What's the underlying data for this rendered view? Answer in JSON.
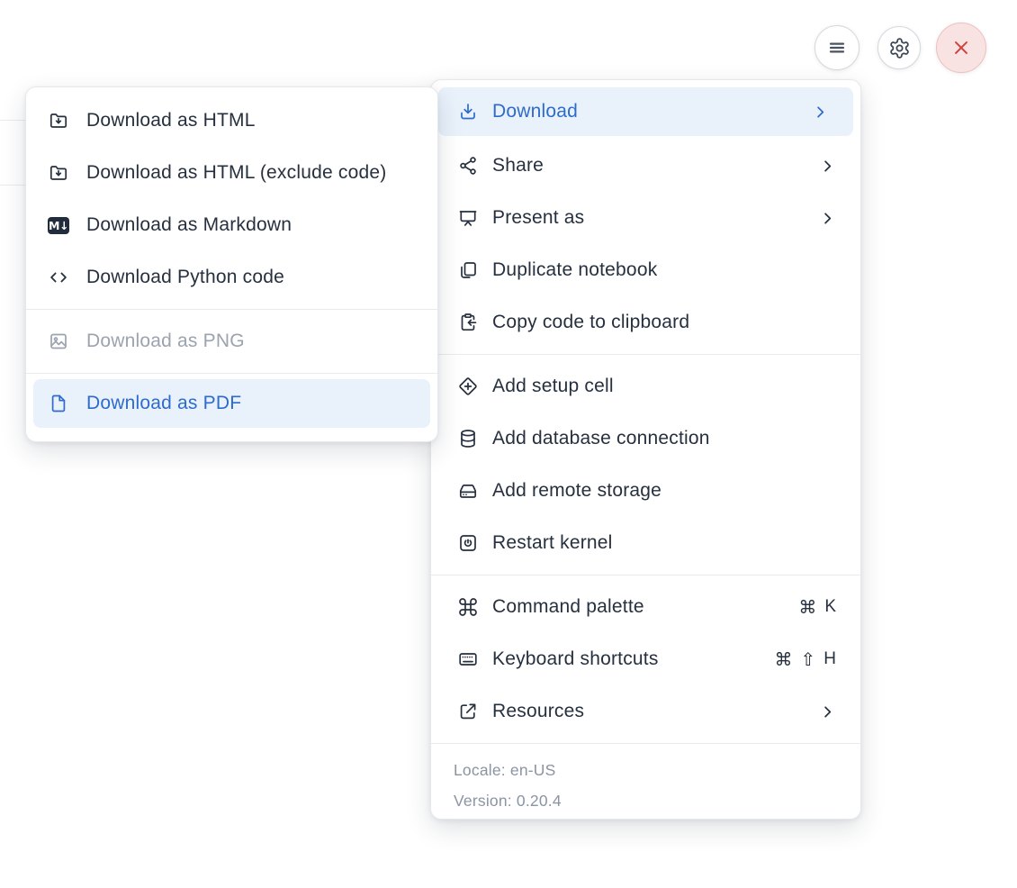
{
  "toolbar": {
    "menu_button": {
      "icon": "hamburger-icon"
    },
    "settings_button": {
      "icon": "gear-icon"
    },
    "close_button": {
      "icon": "close-icon"
    }
  },
  "submenu": {
    "items": [
      {
        "label": "Download as HTML",
        "icon": "folder-download-icon",
        "state": "normal"
      },
      {
        "label": "Download as HTML (exclude code)",
        "icon": "folder-download-icon",
        "state": "normal"
      },
      {
        "label": "Download as Markdown",
        "icon": "markdown-icon",
        "badge": "M↓",
        "state": "normal"
      },
      {
        "label": "Download Python code",
        "icon": "code-icon",
        "state": "normal"
      },
      {
        "label": "Download as PNG",
        "icon": "image-icon",
        "state": "disabled"
      },
      {
        "label": "Download as PDF",
        "icon": "file-icon",
        "state": "highlighted"
      }
    ]
  },
  "main_menu": {
    "items": [
      {
        "label": "Download",
        "icon": "download-icon",
        "submenu": true,
        "state": "highlighted"
      },
      {
        "label": "Share",
        "icon": "share-icon",
        "submenu": true,
        "state": "normal"
      },
      {
        "label": "Present as",
        "icon": "presentation-icon",
        "submenu": true,
        "state": "normal"
      },
      {
        "label": "Duplicate notebook",
        "icon": "duplicate-icon",
        "state": "normal"
      },
      {
        "label": "Copy code to clipboard",
        "icon": "clipboard-arrow-icon",
        "state": "normal"
      },
      {
        "label": "Add setup cell",
        "icon": "diamond-plus-icon",
        "state": "normal"
      },
      {
        "label": "Add database connection",
        "icon": "database-icon",
        "state": "normal"
      },
      {
        "label": "Add remote storage",
        "icon": "hard-drive-icon",
        "state": "normal"
      },
      {
        "label": "Restart kernel",
        "icon": "power-square-icon",
        "state": "normal"
      },
      {
        "label": "Command palette",
        "icon": "command-icon",
        "shortcut": [
          "⌘",
          "K"
        ],
        "state": "normal"
      },
      {
        "label": "Keyboard shortcuts",
        "icon": "keyboard-icon",
        "shortcut": [
          "⌘",
          "⇧",
          "H"
        ],
        "state": "normal"
      },
      {
        "label": "Resources",
        "icon": "external-link-icon",
        "submenu": true,
        "state": "normal"
      }
    ],
    "footer": {
      "locale": "Locale: en-US",
      "version": "Version: 0.20.4"
    }
  },
  "colors": {
    "accent_blue": "#2d6bcc",
    "highlight_bg": "#e9f1fb",
    "text_dark": "#26303f",
    "text_disabled": "#9ba3af",
    "text_muted": "#8b94a3",
    "danger_red": "#cd4440",
    "danger_bg": "#f9e3e2",
    "divider": "#e7eaee"
  }
}
